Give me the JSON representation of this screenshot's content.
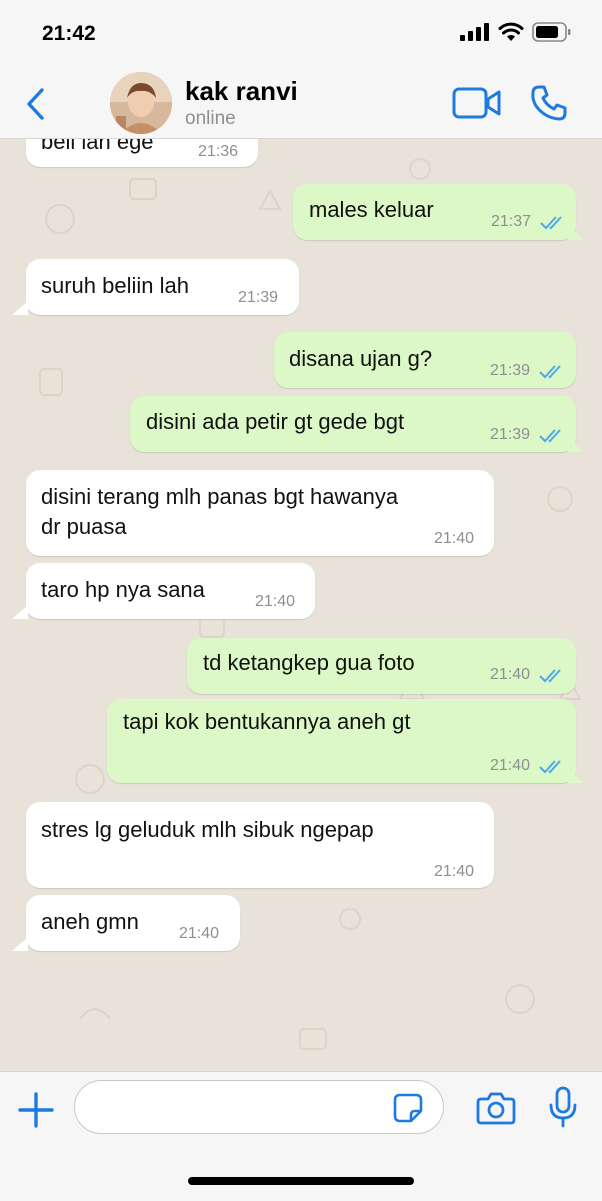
{
  "status_bar": {
    "time": "21:42"
  },
  "header": {
    "contact_name": "kak ranvi",
    "contact_status": "online"
  },
  "messages": [
    {
      "dir": "in",
      "text": "beli lah ege",
      "time": "21:36"
    },
    {
      "dir": "out",
      "text": "males keluar",
      "time": "21:37",
      "read": true
    },
    {
      "dir": "in",
      "text": "suruh beliin lah",
      "time": "21:39"
    },
    {
      "dir": "out",
      "text": "disana ujan g?",
      "time": "21:39",
      "read": true
    },
    {
      "dir": "out",
      "text": "disini ada petir gt gede bgt",
      "time": "21:39",
      "read": true
    },
    {
      "dir": "in",
      "text": "disini terang mlh panas bgt hawanya",
      "text2": "dr puasa",
      "time": "21:40"
    },
    {
      "dir": "in",
      "text": "taro hp nya sana",
      "time": "21:40"
    },
    {
      "dir": "out",
      "text": "td ketangkep gua foto",
      "time": "21:40",
      "read": true
    },
    {
      "dir": "out",
      "text": "tapi kok bentukannya aneh gt",
      "time": "21:40",
      "read": true
    },
    {
      "dir": "in",
      "text": "stres lg geluduk mlh sibuk ngepap",
      "time": "21:40"
    },
    {
      "dir": "in",
      "text": "aneh gmn",
      "time": "21:40"
    }
  ],
  "composer": {
    "placeholder": ""
  },
  "colors": {
    "accent": "#1f7ae0",
    "incoming_bubble": "#ffffff",
    "outgoing_bubble": "#dcf8c6",
    "chat_background": "#e9e2d9",
    "read_tick": "#4fa8e8"
  },
  "icons": [
    "back-chevron-icon",
    "video-call-icon",
    "phone-icon",
    "plus-icon",
    "sticker-icon",
    "camera-icon",
    "microphone-icon",
    "double-check-icon"
  ]
}
